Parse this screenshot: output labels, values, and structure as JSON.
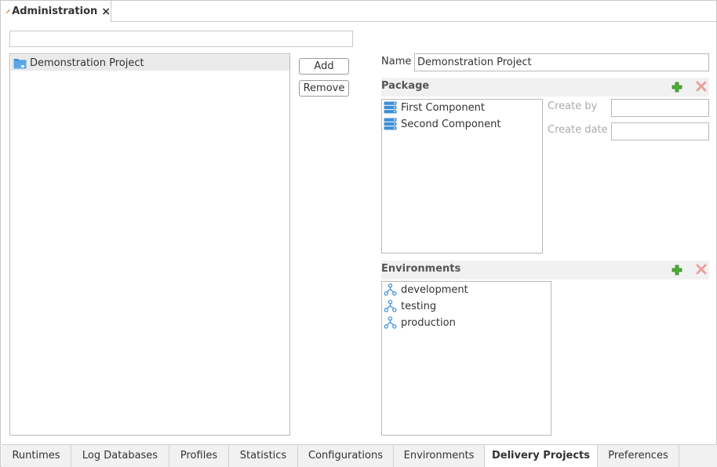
{
  "window": {
    "tab_title": "Administration",
    "tab_icon": "wrench-icon",
    "close_symbol": "×"
  },
  "search": {
    "value": "",
    "placeholder": ""
  },
  "projects": {
    "items": [
      {
        "label": "Demonstration Project",
        "icon": "folder-icon",
        "selected": true
      }
    ]
  },
  "actions": {
    "add_label": "Add",
    "remove_label": "Remove"
  },
  "details": {
    "name_label": "Name",
    "name_value": "Demonstration Project",
    "package": {
      "title": "Package",
      "items": [
        {
          "label": "First Component",
          "icon": "server-icon"
        },
        {
          "label": "Second Component",
          "icon": "server-icon"
        }
      ]
    },
    "create_by_label": "Create by",
    "create_by_value": "",
    "create_date_label": "Create date",
    "create_date_value": "",
    "environments": {
      "title": "Environments",
      "items": [
        {
          "label": "development",
          "icon": "network-icon"
        },
        {
          "label": "testing",
          "icon": "network-icon"
        },
        {
          "label": "production",
          "icon": "network-icon"
        }
      ]
    }
  },
  "bottom_tabs": [
    {
      "label": "Runtimes",
      "active": false
    },
    {
      "label": "Log Databases",
      "active": false
    },
    {
      "label": "Profiles",
      "active": false
    },
    {
      "label": "Statistics",
      "active": false
    },
    {
      "label": "Configurations",
      "active": false
    },
    {
      "label": "Environments",
      "active": false
    },
    {
      "label": "Delivery Projects",
      "active": true
    },
    {
      "label": "Preferences",
      "active": false
    }
  ],
  "colors": {
    "accent_blue": "#3d8fd6",
    "add_green": "#4caf30",
    "delete_red": "#e8a0a0",
    "wrench_orange": "#e8a040"
  }
}
